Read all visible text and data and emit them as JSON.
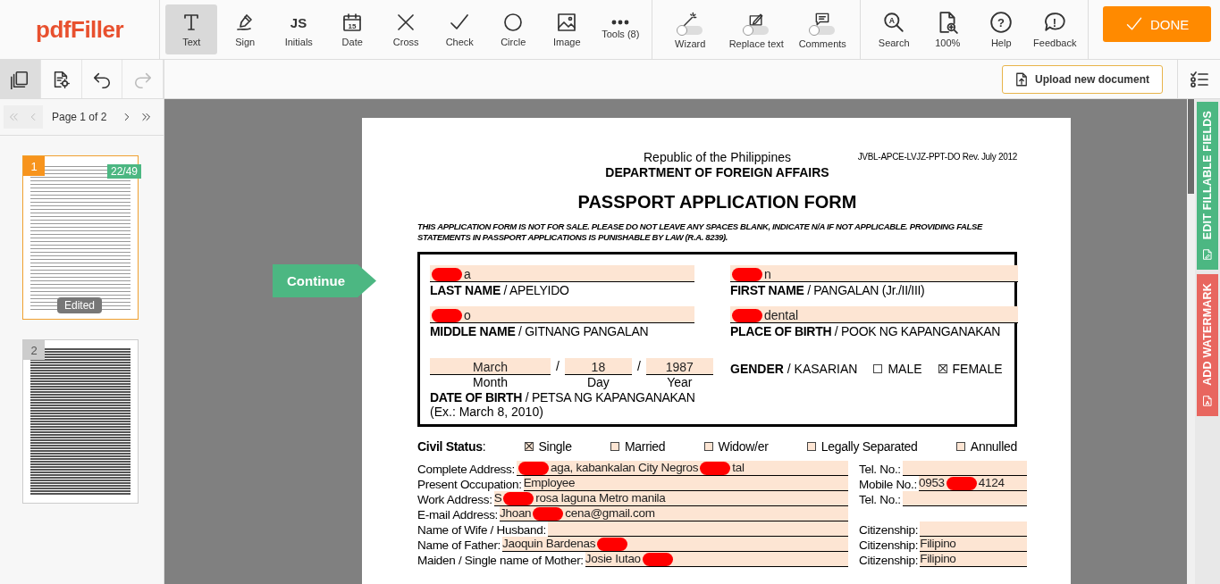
{
  "toolbar": {
    "logo": "pdfFiller",
    "tools": [
      {
        "label": "Text",
        "kind": "text",
        "selected": true
      },
      {
        "label": "Sign",
        "kind": "pen",
        "selected": false
      },
      {
        "label": "Initials",
        "kind": "letters",
        "icon_text": "JS",
        "selected": false
      },
      {
        "label": "Date",
        "kind": "calendar",
        "icon_text": "15",
        "selected": false
      },
      {
        "label": "Cross",
        "kind": "cross",
        "selected": false
      },
      {
        "label": "Check",
        "kind": "check",
        "selected": false
      },
      {
        "label": "Circle",
        "kind": "circle",
        "selected": false
      },
      {
        "label": "Image",
        "kind": "image",
        "selected": false
      },
      {
        "label": "Tools (8)",
        "kind": "dots",
        "selected": false
      }
    ],
    "toggles": [
      {
        "label": "Wizard",
        "kind": "wand",
        "on": false
      },
      {
        "label": "Replace text",
        "kind": "edit",
        "on": false
      },
      {
        "label": "Comments",
        "kind": "comment",
        "on": false
      }
    ],
    "utilities": [
      {
        "label": "Search",
        "kind": "search",
        "icon_text": "A"
      },
      {
        "label": "100%",
        "kind": "zoom"
      },
      {
        "label": "Help",
        "kind": "help",
        "icon_text": "?"
      },
      {
        "label": "Feedback",
        "kind": "feedback",
        "icon_text": "!"
      }
    ],
    "done_button": "DONE"
  },
  "subtoolbar": {
    "tools": [
      {
        "kind": "pages",
        "selected": true,
        "disabled": false
      },
      {
        "kind": "settings",
        "selected": false,
        "disabled": false
      },
      {
        "kind": "undo",
        "selected": false,
        "disabled": false
      },
      {
        "kind": "redo",
        "selected": false,
        "disabled": true
      }
    ],
    "upload_button": "Upload new document"
  },
  "sidebar": {
    "pager": {
      "label": "Page 1 of 2",
      "buttons": [
        {
          "kind": "first",
          "disabled": true
        },
        {
          "kind": "prev",
          "disabled": true
        },
        {
          "kind": "next",
          "disabled": false
        },
        {
          "kind": "last",
          "disabled": false
        }
      ]
    },
    "thumbnails": [
      {
        "number": "1",
        "selected": true,
        "badge": "22/49",
        "status": "Edited"
      },
      {
        "number": "2",
        "selected": false
      }
    ]
  },
  "continue_button": "Continue",
  "document": {
    "agency": "Republic of the Philippines",
    "department": "DEPARTMENT OF FOREIGN AFFAIRS",
    "form_code": "JVBL-APCE-LVJZ-PPT-DO Rev. July 2012",
    "title": "PASSPORT APPLICATION FORM",
    "notice": "THIS APPLICATION FORM IS NOT FOR SALE. PLEASE DO NOT LEAVE ANY SPACES BLANK, INDICATE N/A IF NOT APPLICABLE. PROVIDING FALSE STATEMENTS IN PASSPORT APPLICATIONS IS PUNISHABLE BY LAW (R.A. 8239).",
    "name_fields": [
      {
        "label": "**LAST NAME** / APELYIDO",
        "value": [
          {
            "kind": "redacted"
          },
          {
            "kind": "text",
            "text": "a"
          }
        ]
      },
      {
        "label": "**FIRST NAME** / PANGALAN (Jr./II/III)",
        "value": [
          {
            "kind": "redacted"
          },
          {
            "kind": "text",
            "text": "n"
          }
        ]
      },
      {
        "label": "**MIDDLE NAME** / GITNANG PANGALAN",
        "value": [
          {
            "kind": "redacted"
          },
          {
            "kind": "text",
            "text": "o"
          }
        ]
      },
      {
        "label": "**PLACE OF BIRTH** / POOK NG KAPANGANAKAN",
        "value": [
          {
            "kind": "redacted"
          },
          {
            "kind": "text",
            "text": "dental"
          }
        ]
      }
    ],
    "birth_date": {
      "parts": [
        {
          "value": "March",
          "caption": "Month"
        },
        {
          "value": "18",
          "caption": "Day"
        },
        {
          "value": "1987",
          "caption": "Year"
        }
      ],
      "separators": [
        "/",
        "/"
      ],
      "label": "**DATE OF BIRTH** / PETSA NG KAPANGANAKAN",
      "example": "(Ex.: March 8, 2010)"
    },
    "gender": {
      "label": "**GENDER** / KASARIAN",
      "options": [
        {
          "label": "MALE",
          "checked": false
        },
        {
          "label": "FEMALE",
          "checked": true
        }
      ]
    },
    "civil_status": {
      "label": "**Civil Status**:",
      "options": [
        {
          "label": "Single",
          "checked": true
        },
        {
          "label": "Married",
          "checked": false
        },
        {
          "label": "Widow/er",
          "checked": false
        },
        {
          "label": "Legally Separated",
          "checked": false
        },
        {
          "label": "Annulled",
          "checked": false
        }
      ]
    },
    "info_rows": [
      {
        "label": "Complete Address:",
        "value": [
          {
            "kind": "redacted"
          },
          {
            "kind": "text",
            "text": "aga, kabankalan City Negros"
          },
          {
            "kind": "redacted"
          },
          {
            "kind": "text",
            "text": "tal"
          }
        ],
        "right_label": "Tel. No.:"
      },
      {
        "label": "Present Occupation:",
        "value": [
          {
            "kind": "text",
            "text": "Employee"
          }
        ],
        "right_label": "Mobile No.:",
        "right_value": [
          {
            "kind": "text",
            "text": "0953"
          },
          {
            "kind": "redacted"
          },
          {
            "kind": "text",
            "text": "4124"
          }
        ]
      },
      {
        "label": "Work Address:",
        "value": [
          {
            "kind": "text",
            "text": "S"
          },
          {
            "kind": "redacted"
          },
          {
            "kind": "text",
            "text": "rosa laguna  Metro manila"
          }
        ],
        "right_label": "Tel. No.:"
      },
      {
        "label": "E-mail Address:",
        "value": [
          {
            "kind": "text",
            "text": "Jhoan"
          },
          {
            "kind": "redacted"
          },
          {
            "kind": "text",
            "text": "cena@gmail.com"
          }
        ]
      },
      {
        "label": "Name of Wife / Husband:",
        "right_label": "Citizenship:"
      },
      {
        "label": "Name of Father:",
        "value": [
          {
            "kind": "text",
            "text": "Jaoquin Bardenas"
          },
          {
            "kind": "redacted"
          }
        ],
        "right_label": "Citizenship:",
        "right_value": [
          {
            "kind": "text",
            "text": "Filipino"
          }
        ]
      },
      {
        "label": "Maiden / Single name of Mother:",
        "value": [
          {
            "kind": "text",
            "text": "Josie Iutao"
          },
          {
            "kind": "redacted"
          }
        ],
        "right_label": "Citizenship:",
        "right_value": [
          {
            "kind": "text",
            "text": "Filipino"
          }
        ]
      }
    ]
  },
  "side_tabs": [
    {
      "label": "EDIT FILLABLE FIELDS",
      "kind": "fields",
      "color": "#4cb782"
    },
    {
      "label": "ADD WATERMARK",
      "kind": "watermark",
      "color": "#e8665f"
    }
  ]
}
